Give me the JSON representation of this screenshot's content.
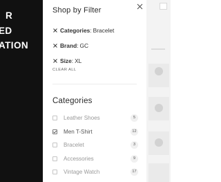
{
  "promo": {
    "lines": [
      "R",
      "ED",
      "ATION"
    ]
  },
  "filter_panel": {
    "title": "Shop by Filter",
    "active_filters": [
      {
        "key": "Categories",
        "value": "Bracelet"
      },
      {
        "key": "Brand",
        "value": "GC"
      },
      {
        "key": "Size",
        "value": "XL"
      }
    ],
    "clear_all_label": "CLEAR ALL"
  },
  "categories": {
    "title": "Categories",
    "items": [
      {
        "label": "Leather Shoes",
        "count": "5",
        "checked": false
      },
      {
        "label": "Men T-Shirt",
        "count": "12",
        "checked": true
      },
      {
        "label": "Bracelet",
        "count": "3",
        "checked": false
      },
      {
        "label": "Accessories",
        "count": "9",
        "checked": false
      },
      {
        "label": "Vintage Watch",
        "count": "17",
        "checked": false
      }
    ]
  },
  "icons": {
    "close": "close-icon",
    "remove_filter": "x-icon",
    "checkbox_checked": "check-icon"
  },
  "colors": {
    "dark_background": "#111111",
    "panel_background": "#ffffff",
    "text_primary": "#2a2a2a",
    "text_muted": "#999999",
    "count_badge": "#f0f0f0"
  }
}
